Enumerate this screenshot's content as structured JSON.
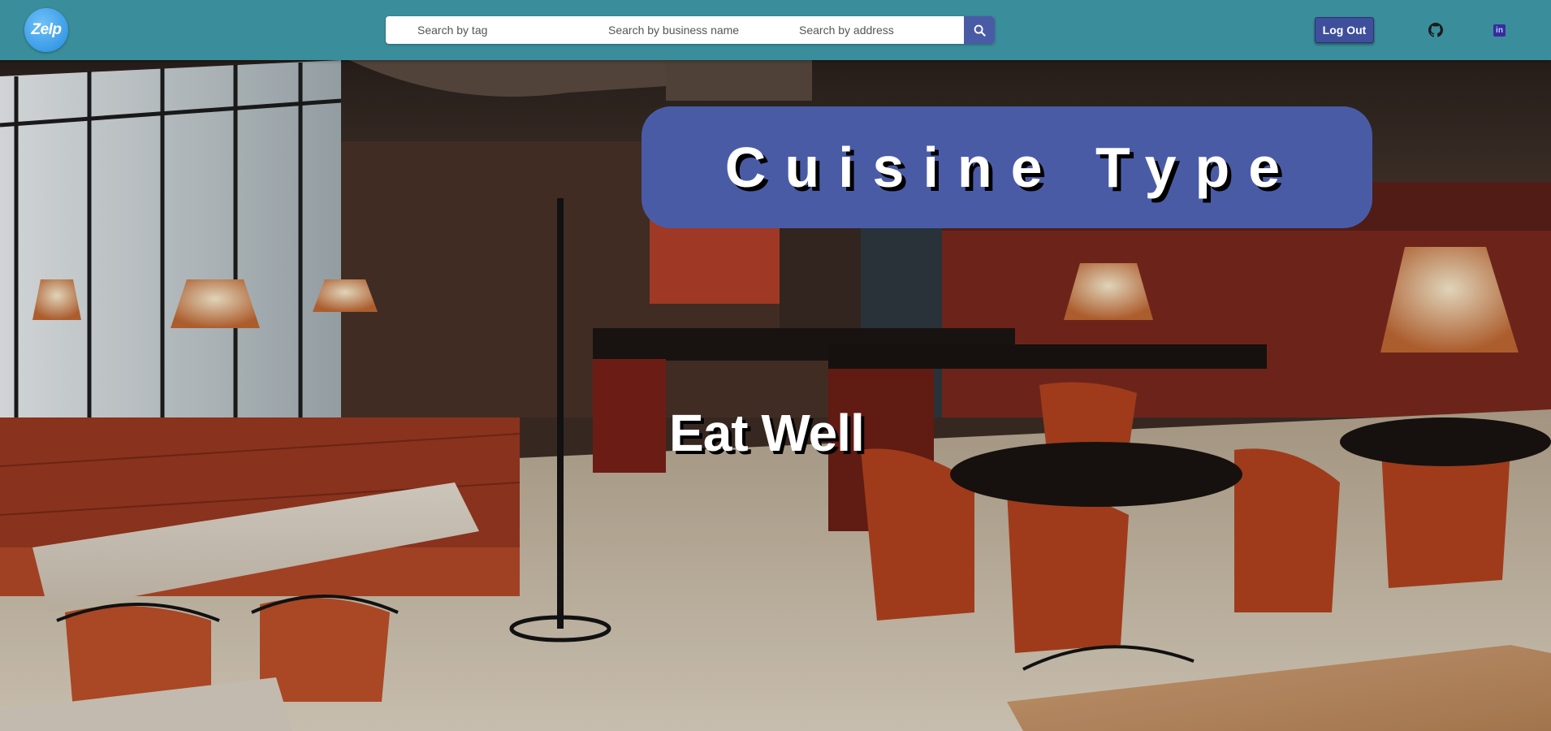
{
  "navbar": {
    "logo_text": "Zelp",
    "search": {
      "tag_placeholder": "Search by tag",
      "name_placeholder": "Search by business name",
      "address_placeholder": "Search by address",
      "button_icon": "search-icon"
    },
    "logout_label": "Log Out",
    "github_icon": "github-icon",
    "linkedin_icon": "linkedin-icon",
    "linkedin_glyph": "in"
  },
  "hero": {
    "title": "Cuisine Type",
    "tagline": "Eat Well",
    "background": "restaurant-interior-photo"
  },
  "colors": {
    "navbar": "#3a8e9c",
    "accent": "#4a5ba6",
    "logo": "#3a9ce8"
  }
}
